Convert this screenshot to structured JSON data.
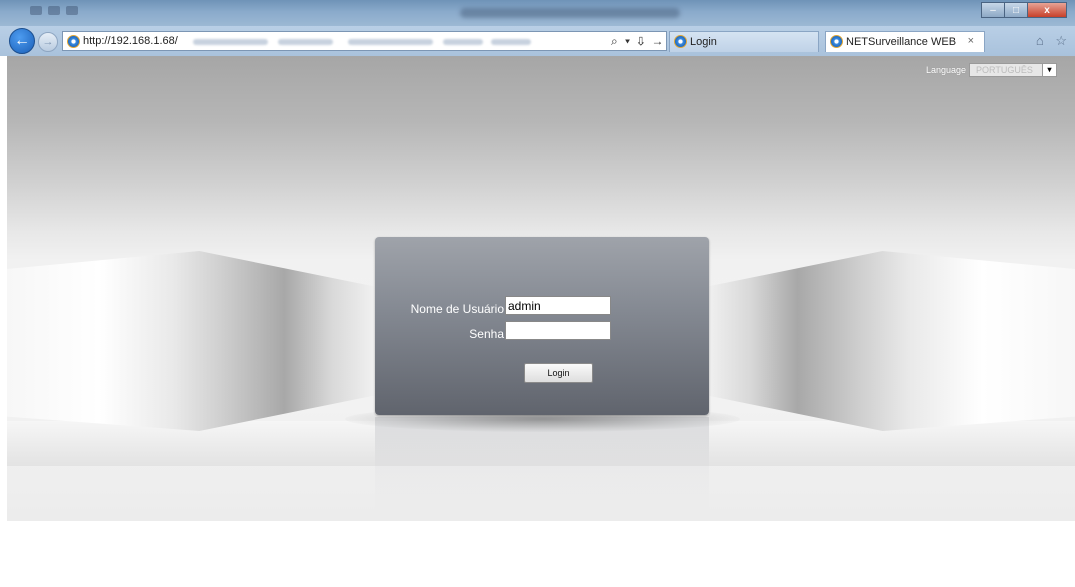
{
  "browser": {
    "address_url": "http://192.168.1.68/",
    "tabs": [
      {
        "label": "Login"
      },
      {
        "label": "NETSurveillance WEB",
        "close": "×"
      }
    ],
    "back_icon": "back-arrow-icon",
    "forward_icon": "forward-arrow-icon",
    "window_buttons": {
      "minimize": "–",
      "maximize": "□",
      "close": "x"
    },
    "address_tools": "⌕ ▾ ⇩ →",
    "nav_right_icons": "⌂ ☆"
  },
  "page": {
    "language": {
      "label": "Language",
      "selected": "PORTUGUÊS",
      "arrow": "▾"
    },
    "login": {
      "username_label": "Nome de Usuário",
      "username_value": "admin",
      "password_label": "Senha",
      "password_value": "",
      "button_label": "Login"
    }
  },
  "colors": {
    "accent_blue": "#1a5fb8",
    "panel_dark": "#60646d",
    "panel_light": "#9fa3aa"
  }
}
